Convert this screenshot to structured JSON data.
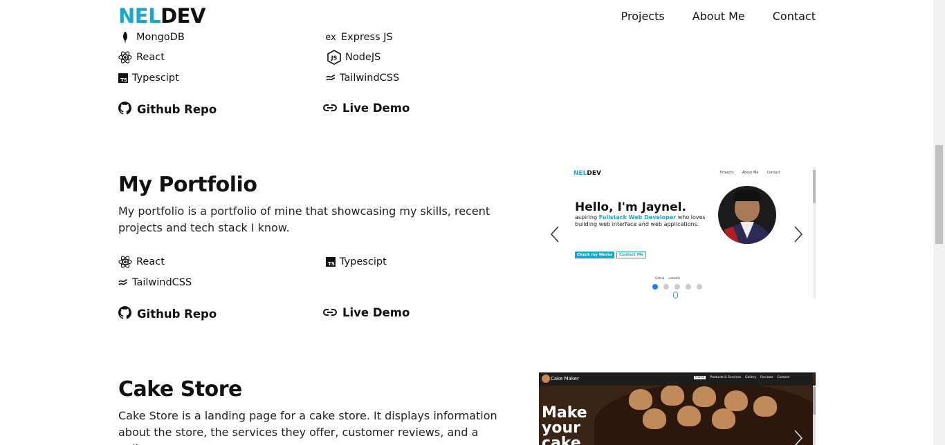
{
  "header": {
    "logo_part1": "NEL",
    "logo_part2": "DEV",
    "nav": [
      "Projects",
      "About Me",
      "Contact"
    ]
  },
  "project_prev": {
    "tech": [
      {
        "name": "MongoDB",
        "icon": "mongodb-icon"
      },
      {
        "name": "Express JS",
        "icon": "express-icon"
      },
      {
        "name": "React",
        "icon": "react-icon"
      },
      {
        "name": "NodeJS",
        "icon": "nodejs-icon"
      },
      {
        "name": "Typescipt",
        "icon": "typescript-icon"
      },
      {
        "name": "TailwindCSS",
        "icon": "tailwind-icon"
      }
    ],
    "github_label": "Github Repo",
    "demo_label": "Live Demo"
  },
  "project_portfolio": {
    "title": "My Portfolio",
    "description": "My portfolio is a portfolio of mine that showcasing my skills, recent projects and tech stack I know.",
    "tech": [
      {
        "name": "React",
        "icon": "react-icon"
      },
      {
        "name": "Typescipt",
        "icon": "typescript-icon"
      },
      {
        "name": "TailwindCSS",
        "icon": "tailwind-icon"
      }
    ],
    "github_label": "Github Repo",
    "demo_label": "Live Demo",
    "preview": {
      "logo_part1": "NEL",
      "logo_part2": "DEV",
      "nav": [
        "Projects",
        "About Me",
        "Contact"
      ],
      "heading": "Hello, I'm Jaynel.",
      "sub_pre": "aspiring ",
      "sub_highlight": "Fullstack Web Developer",
      "sub_post": " who loves building web interface and web applications.",
      "btn_primary": "Check my Works",
      "btn_secondary": "Contact Me",
      "social": [
        "Github",
        "LinkedIn"
      ],
      "slides": 5,
      "active_slide": 1
    }
  },
  "project_cake": {
    "title": "Cake Store",
    "description": "Cake Store is a landing page for a cake store. It displays information about the store, the services they offer, customer reviews, and a gallery",
    "preview": {
      "brand": "Cake Maker",
      "nav": [
        "Home",
        "Products & Services",
        "Gallery",
        "Reviews",
        "Contact"
      ],
      "hero": "Make your cake"
    }
  },
  "colors": {
    "accent": "#1aa7c9",
    "text": "#111111",
    "dot_active": "#1a7ff0"
  }
}
